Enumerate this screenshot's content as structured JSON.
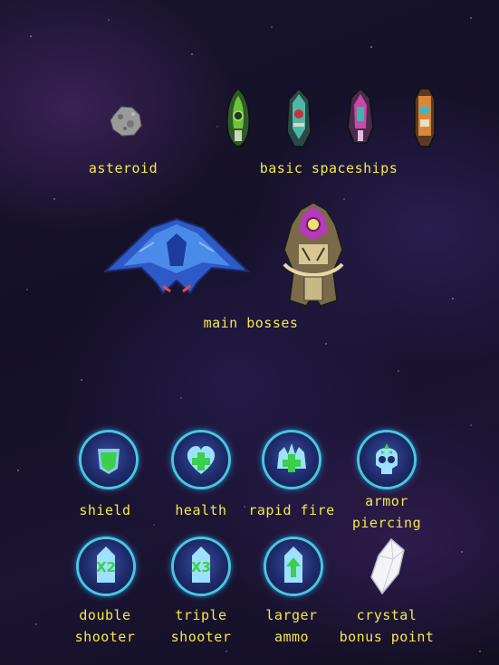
{
  "enemies": {
    "asteroid_label": "asteroid",
    "spaceships_label": "basic spaceships",
    "bosses_label": "main bosses"
  },
  "powerups": [
    {
      "line1": "shield",
      "line2": ""
    },
    {
      "line1": "health",
      "line2": ""
    },
    {
      "line1": "rapid fire",
      "line2": ""
    },
    {
      "line1": "armor",
      "line2": "piercing"
    },
    {
      "line1": "double",
      "line2": "shooter"
    },
    {
      "line1": "triple",
      "line2": "shooter"
    },
    {
      "line1": "larger",
      "line2": "ammo"
    },
    {
      "line1": "crystal",
      "line2": "bonus point"
    }
  ],
  "badges": {
    "double": "X2",
    "triple": "X3"
  },
  "colors": {
    "label": "#f2ea4a",
    "orb_ring": "#49c8d8",
    "powerup_green": "#3ad04a"
  }
}
